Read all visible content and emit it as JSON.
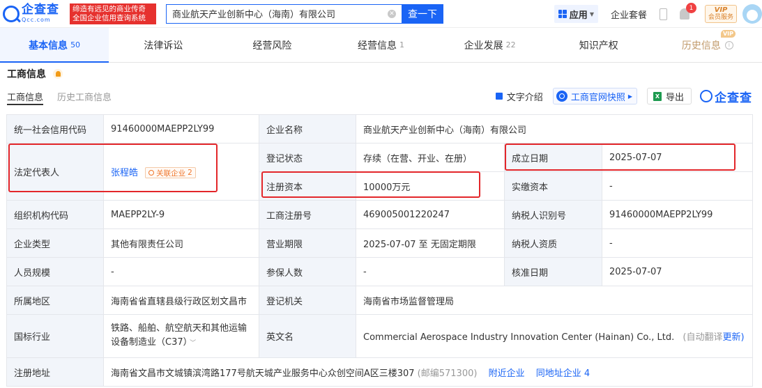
{
  "header": {
    "logo_cn": "企查查",
    "logo_en": "Qcc.com",
    "slogan_line1": "缔造有远见的商业传奇",
    "slogan_line2": "全国企业信用查询系统",
    "search_value": "商业航天产业创新中心（海南）有限公司",
    "search_button": "查一下",
    "app_label": "应用",
    "suite_label": "企业套餐",
    "notification_count": "1",
    "vip_title": "VIP",
    "vip_subtitle": "会员服务"
  },
  "tabs": [
    {
      "label": "基本信息",
      "count": "50"
    },
    {
      "label": "法律诉讼",
      "count": ""
    },
    {
      "label": "经营风险",
      "count": ""
    },
    {
      "label": "经营信息",
      "count": "1"
    },
    {
      "label": "企业发展",
      "count": "22"
    },
    {
      "label": "知识产权",
      "count": ""
    },
    {
      "label": "历史信息",
      "count": "",
      "tag": "VIP"
    }
  ],
  "section": {
    "title": "工商信息",
    "subtabs": [
      "工商信息",
      "历史工商信息"
    ],
    "tools": {
      "text_intro": "文字介绍",
      "snapshot": "工商官网快照",
      "export": "导出",
      "brand": "企查查"
    }
  },
  "table": {
    "r1": {
      "l1": "统一社会信用代码",
      "v1": "91460000MAEPP2LY99",
      "l2": "企业名称",
      "v2": "商业航天产业创新中心（海南）有限公司"
    },
    "legal_rep": {
      "label": "法定代表人",
      "name": "张程皓",
      "tag": "关联企业",
      "tag_count": "2"
    },
    "r2": {
      "l2": "登记状态",
      "v2": "存续（在营、开业、在册）",
      "l3": "成立日期",
      "v3": "2025-07-07"
    },
    "r3": {
      "l2": "注册资本",
      "v2": "10000万元",
      "l3": "实缴资本",
      "v3": "-"
    },
    "r4": {
      "l1": "组织机构代码",
      "v1": "MAEPP2LY-9",
      "l2": "工商注册号",
      "v2": "469005001220247",
      "l3": "纳税人识别号",
      "v3": "91460000MAEPP2LY99"
    },
    "r5": {
      "l1": "企业类型",
      "v1": "其他有限责任公司",
      "l2": "营业期限",
      "v2": "2025-07-07 至 无固定期限",
      "l3": "纳税人资质",
      "v3": "-"
    },
    "r6": {
      "l1": "人员规模",
      "v1": "-",
      "l2": "参保人数",
      "v2": "-",
      "l3": "核准日期",
      "v3": "2025-07-07"
    },
    "r7": {
      "l1": "所属地区",
      "v1": "海南省省直辖县级行政区划文昌市",
      "l2": "登记机关",
      "v2": "海南省市场监督管理局"
    },
    "r8": {
      "l1": "国标行业",
      "v1": "铁路、船舶、航空航天和其他运输设备制造业（C37）",
      "l2": "英文名",
      "v2": "Commercial Aerospace Industry Innovation Center (Hainan) Co., Ltd.",
      "translate": "(自动翻译",
      "update": "更新)"
    },
    "r9": {
      "l1": "注册地址",
      "v1": "海南省文昌市文城镇滨湾路177号航天城产业服务中心众创空间A区三楼307",
      "postal": "(邮编571300)",
      "nearby": "附近企业",
      "same_addr": "同地址企业",
      "same_count": "4"
    }
  },
  "colors": {
    "brand_blue": "#1a64f5",
    "highlight_red": "#e3262a",
    "label_bg": "#f2f5fa"
  }
}
